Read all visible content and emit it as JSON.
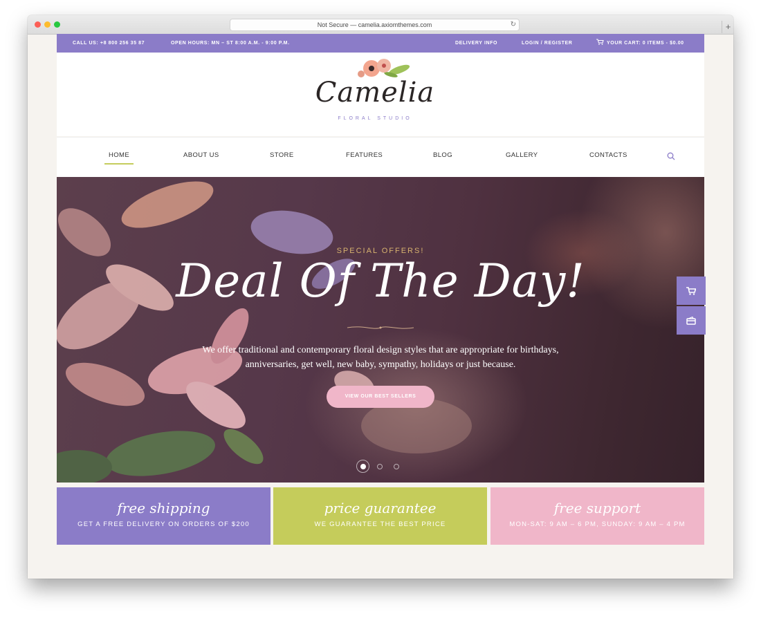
{
  "browser": {
    "url": "Not Secure — camelia.axiomthemes.com",
    "reload_icon": "reload-icon",
    "new_tab": "+"
  },
  "topbar": {
    "phone": "CALL US: +8 800 256 35 87",
    "hours": "OPEN HOURS: MN – ST 8:00 A.M. - 9:00 P.M.",
    "delivery": "DELIVERY INFO",
    "login": "LOGIN / REGISTER",
    "cart": "YOUR CART:  0 ITEMS - $0.00",
    "bg_color": "#8b7cc8"
  },
  "logo": {
    "name": "Camelia",
    "subtitle": "FLORAL STUDIO"
  },
  "nav": {
    "items": [
      {
        "label": "HOME",
        "active": true
      },
      {
        "label": "ABOUT US"
      },
      {
        "label": "STORE"
      },
      {
        "label": "FEATURES"
      },
      {
        "label": "BLOG"
      },
      {
        "label": "GALLERY"
      },
      {
        "label": "CONTACTS"
      }
    ],
    "search_icon": "search-icon",
    "active_underline_color": "#c5cc5b"
  },
  "hero": {
    "kicker": "SPECIAL OFFERS!",
    "title": "Deal Of The Day!",
    "description": "We offer traditional and contemporary floral design styles that are appropriate for birthdays, anniversaries, get well, new baby, sympathy, holidays or just because.",
    "cta": "VIEW OUR BEST SELLERS",
    "slides": 3,
    "active_slide": 1
  },
  "side_buttons": [
    "cart-icon",
    "card-icon"
  ],
  "features": [
    {
      "title": "free shipping",
      "subtitle": "GET A FREE DELIVERY ON ORDERS OF $200",
      "color": "#8b7cc8"
    },
    {
      "title": "price guarantee",
      "subtitle": "WE GUARANTEE THE BEST PRICE",
      "color": "#c5cc5b"
    },
    {
      "title": "free support",
      "subtitle": "MON-SAT: 9 AM – 6 PM, SUNDAY: 9 AM – 4 PM",
      "color": "#f0b6c9"
    }
  ]
}
